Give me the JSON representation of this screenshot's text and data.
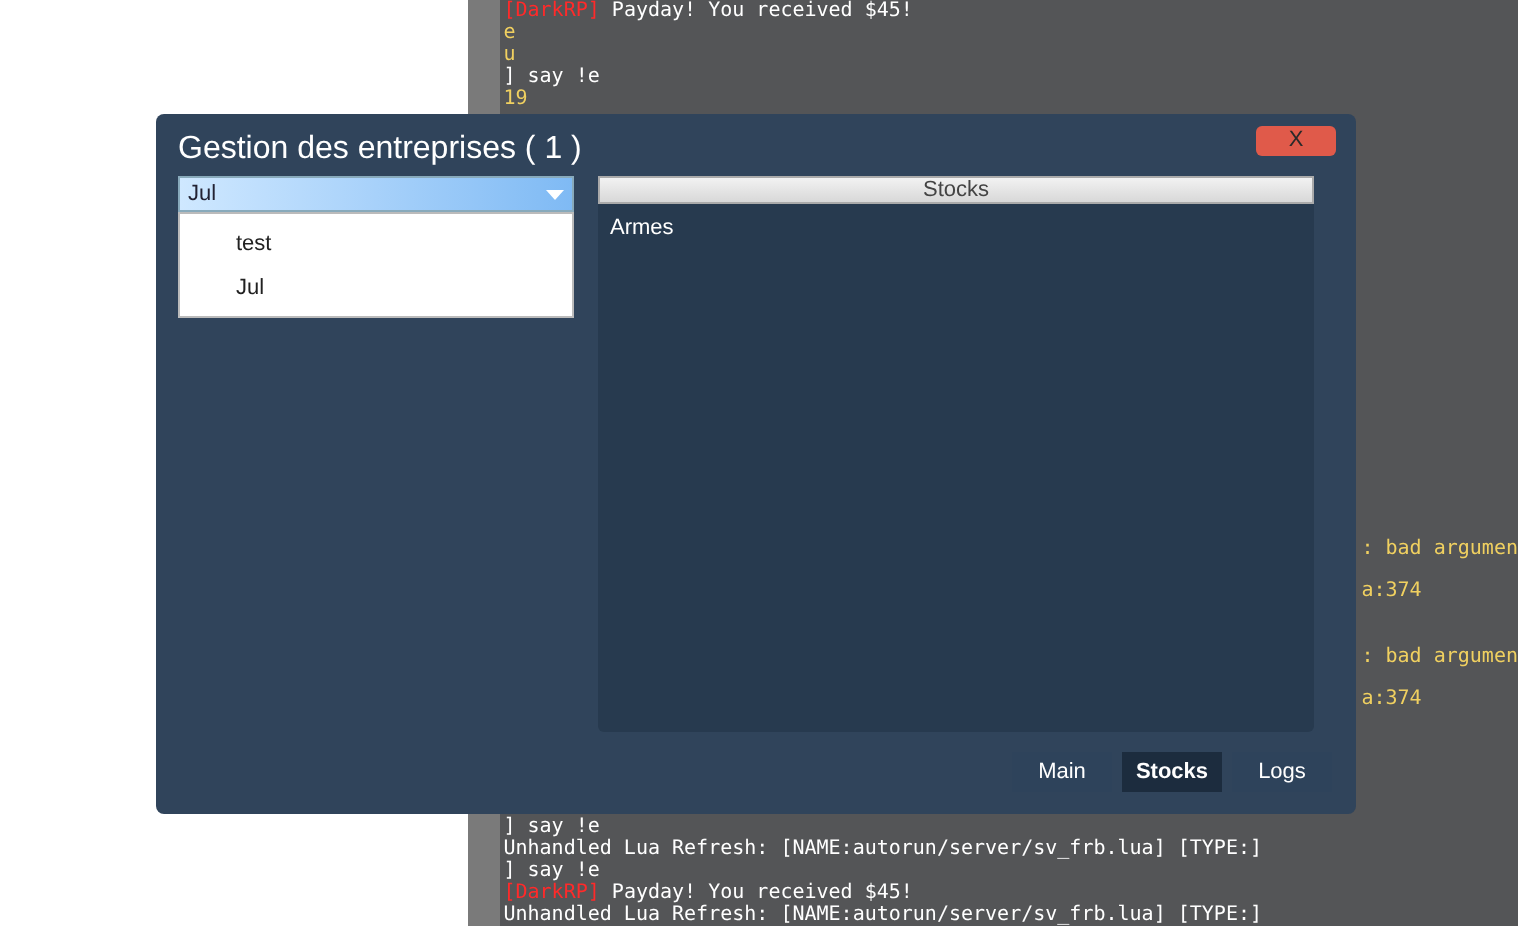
{
  "console": {
    "top_lines": [
      {
        "tag": "[DarkRP]",
        "text": "Payday! You received $45!",
        "color": "#ffffff"
      },
      {
        "text": "e",
        "color": "#f0d060"
      },
      {
        "text": "u",
        "color": "#f0d060"
      },
      {
        "text": "] say !e",
        "color": "#ffffff"
      },
      {
        "text": "19",
        "color": "#f0d060"
      }
    ],
    "side_groups": [
      [
        {
          "text": ": bad argumen",
          "color": "#f0d060"
        },
        {
          "text": "a:374",
          "color": "#f0d060"
        }
      ],
      [
        {
          "text": ": bad argumen",
          "color": "#f0d060"
        },
        {
          "text": "a:374",
          "color": "#f0d060"
        }
      ]
    ],
    "bottom_lines": [
      {
        "text": "] say !e",
        "color": "#ffffff"
      },
      {
        "text": "Unhandled Lua Refresh: [NAME:autorun/server/sv_frb.lua] [TYPE:]",
        "color": "#ffffff"
      },
      {
        "text": "] say !e",
        "color": "#ffffff"
      },
      {
        "tag": "[DarkRP]",
        "text": "Payday! You received $45!",
        "color": "#ffffff"
      },
      {
        "text": "Unhandled Lua Refresh: [NAME:autorun/server/sv_frb.lua] [TYPE:]",
        "color": "#ffffff"
      }
    ]
  },
  "dialog": {
    "title": "Gestion des entreprises ( 1 )",
    "close": "X",
    "dropdown": {
      "value": "Jul",
      "expanded": true,
      "options": [
        "test",
        "Jul"
      ]
    },
    "panel": {
      "header": "Stocks",
      "items": [
        "Armes"
      ]
    },
    "tabs": [
      {
        "label": "Main",
        "selected": false
      },
      {
        "label": "Stocks",
        "selected": true
      },
      {
        "label": "Logs",
        "selected": false
      }
    ]
  }
}
